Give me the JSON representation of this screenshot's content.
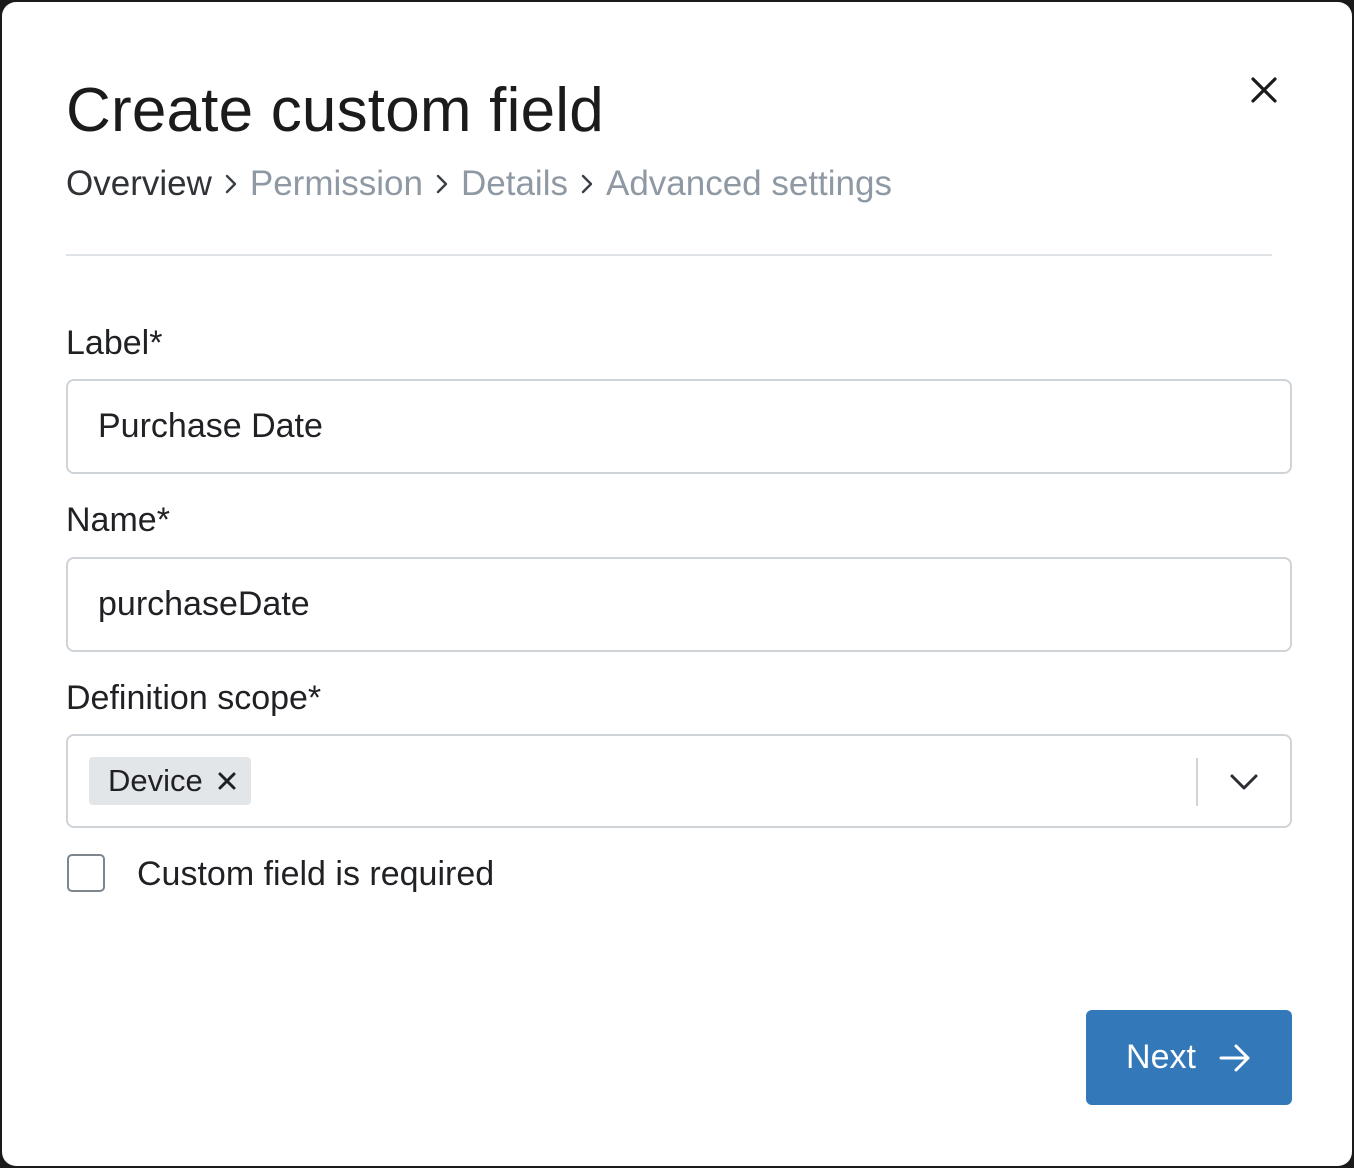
{
  "dialog": {
    "title": "Create custom field",
    "close_icon": "close-icon"
  },
  "breadcrumb": {
    "steps": [
      {
        "label": "Overview",
        "active": true
      },
      {
        "label": "Permission",
        "active": false
      },
      {
        "label": "Details",
        "active": false
      },
      {
        "label": "Advanced settings",
        "active": false
      }
    ],
    "separator_icon": "chevron-right-icon"
  },
  "form": {
    "label_field": {
      "label": "Label*",
      "value": "Purchase Date"
    },
    "name_field": {
      "label": "Name*",
      "value": "purchaseDate"
    },
    "scope_field": {
      "label": "Definition scope*",
      "selected_tags": [
        "Device"
      ],
      "tag_remove_icon": "close-icon",
      "dropdown_icon": "chevron-down-icon"
    },
    "required_checkbox": {
      "label": "Custom field is required",
      "checked": false
    }
  },
  "footer": {
    "next_label": "Next",
    "next_icon": "arrow-right-icon"
  },
  "colors": {
    "primary": "#3378b8",
    "breadcrumb_inactive": "#8f99a4",
    "border": "#cfd4d9",
    "tag_bg": "#e3e6e9"
  }
}
